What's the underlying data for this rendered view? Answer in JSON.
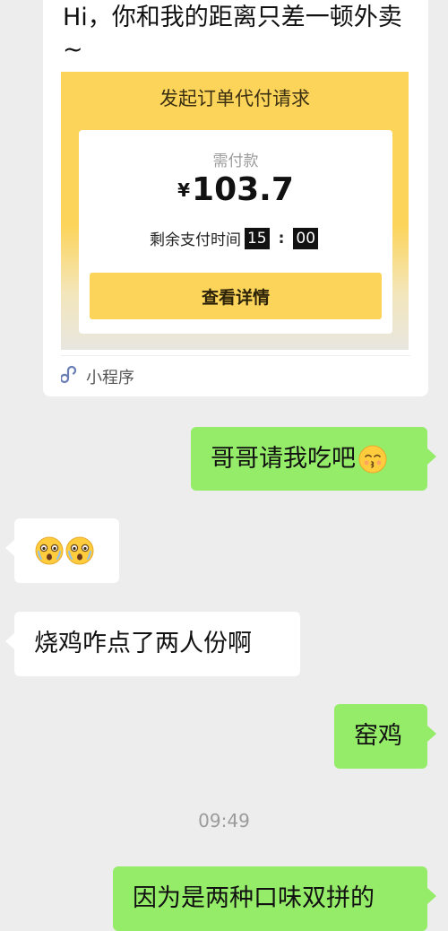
{
  "order_card": {
    "message_text": "Hi，你和我的距离只差一顿外卖 ~",
    "title": "发起订单代付请求",
    "amount_label": "需付款",
    "currency_symbol": "¥",
    "amount": "103.7",
    "timer_label": "剩余支付时间",
    "timer_minutes": "15",
    "timer_separator": ":",
    "timer_seconds": "00",
    "button_label": "查看详情",
    "footer_label": "小程序",
    "footer_icon": "mini-program-icon"
  },
  "messages": [
    {
      "side": "right",
      "text": "哥哥请我吃吧",
      "emoji": "kissing-face-emoji"
    },
    {
      "side": "left",
      "emojis": [
        "fearful-face-emoji",
        "fearful-face-emoji"
      ]
    },
    {
      "side": "left",
      "text": "烧鸡咋点了两人份啊"
    },
    {
      "side": "right",
      "text": "窑鸡"
    },
    {
      "side": "right",
      "text": "因为是两种口味双拼的"
    }
  ],
  "timestamp": "09:49",
  "colors": {
    "background": "#ededed",
    "outgoing_bubble": "#95ec69",
    "incoming_bubble": "#ffffff",
    "accent_yellow": "#fcd45a"
  }
}
